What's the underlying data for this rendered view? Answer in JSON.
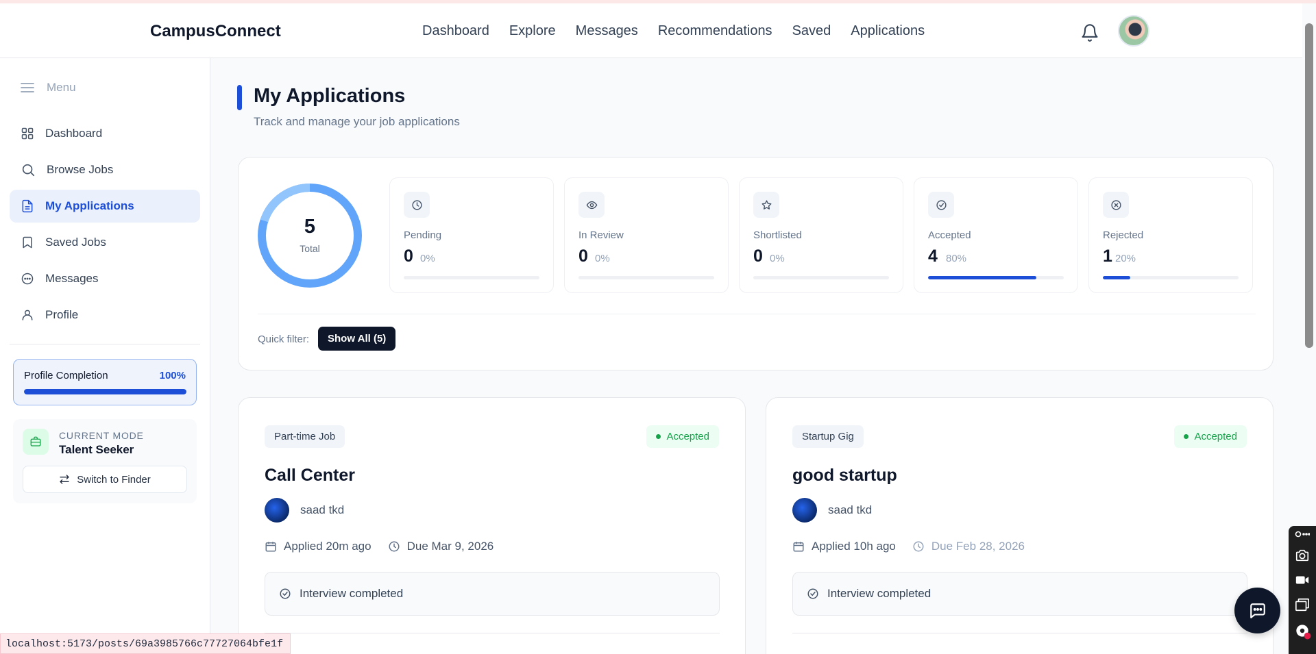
{
  "app": {
    "brand": "CampusConnect"
  },
  "nav": [
    "Dashboard",
    "Explore",
    "Messages",
    "Recommendations",
    "Saved",
    "Applications"
  ],
  "sidebar": {
    "menu_label": "Menu",
    "items": [
      {
        "label": "Dashboard",
        "icon": "grid-icon"
      },
      {
        "label": "Browse Jobs",
        "icon": "search-icon"
      },
      {
        "label": "My Applications",
        "icon": "document-icon",
        "active": true
      },
      {
        "label": "Saved Jobs",
        "icon": "bookmark-icon"
      },
      {
        "label": "Messages",
        "icon": "chat-icon"
      },
      {
        "label": "Profile",
        "icon": "user-icon"
      }
    ],
    "profile_completion": {
      "label": "Profile Completion",
      "value": "100%",
      "fraction": 1.0
    },
    "mode": {
      "caption": "CURRENT MODE",
      "name": "Talent Seeker",
      "switch_label": "Switch to Finder"
    }
  },
  "page": {
    "title": "My Applications",
    "subtitle": "Track and manage your job applications"
  },
  "summary": {
    "total": "5",
    "total_label": "Total",
    "stats": [
      {
        "label": "Pending",
        "value": "0",
        "pct": "0%",
        "fraction": 0.0,
        "icon": "clock-icon"
      },
      {
        "label": "In Review",
        "value": "0",
        "pct": "0%",
        "fraction": 0.0,
        "icon": "eye-icon"
      },
      {
        "label": "Shortlisted",
        "value": "0",
        "pct": "0%",
        "fraction": 0.0,
        "icon": "star-icon"
      },
      {
        "label": "Accepted",
        "value": "4",
        "pct": "80%",
        "fraction": 0.8,
        "icon": "check-circle-icon"
      },
      {
        "label": "Rejected",
        "value": "1",
        "pct": "20%",
        "fraction": 0.2,
        "icon": "x-circle-icon"
      }
    ],
    "filter_label": "Quick filter:",
    "filter_button": "Show All (5)"
  },
  "applications": [
    {
      "type": "Part-time Job",
      "status": "Accepted",
      "title": "Call Center",
      "owner": "saad tkd",
      "applied": "Applied 20m ago",
      "due": "Due Mar 9, 2026",
      "note": "Interview completed"
    },
    {
      "type": "Startup Gig",
      "status": "Accepted",
      "title": "good startup",
      "owner": "saad tkd",
      "applied": "Applied 10h ago",
      "due": "Due Feb 28, 2026",
      "note": "Interview completed"
    }
  ],
  "status_bar": {
    "url": "localhost:5173/posts/69a3985766c77727064bfe1f"
  },
  "colors": {
    "accent": "#1d4ed8",
    "success": "#16a34a",
    "dark": "#0f172a"
  }
}
